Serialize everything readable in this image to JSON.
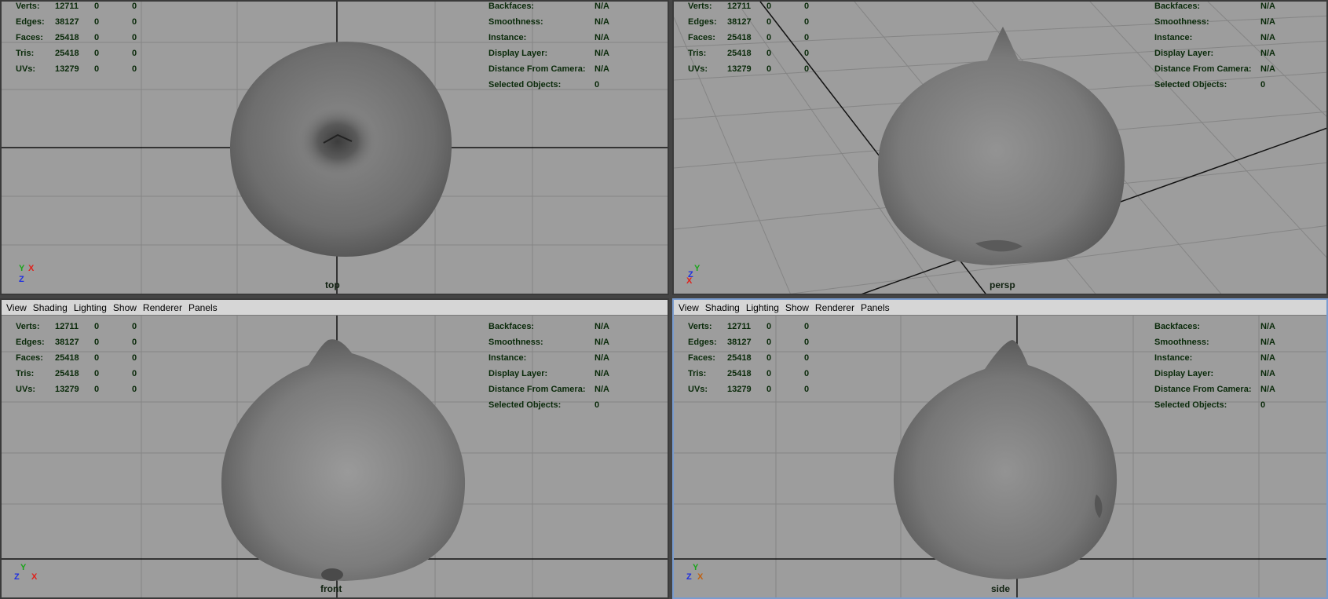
{
  "menu": [
    "View",
    "Shading",
    "Lighting",
    "Show",
    "Renderer",
    "Panels"
  ],
  "hud_left": [
    {
      "label": "Verts:",
      "a": "12711",
      "b": "0",
      "c": "0"
    },
    {
      "label": "Edges:",
      "a": "38127",
      "b": "0",
      "c": "0"
    },
    {
      "label": "Faces:",
      "a": "25418",
      "b": "0",
      "c": "0"
    },
    {
      "label": "Tris:",
      "a": "25418",
      "b": "0",
      "c": "0"
    },
    {
      "label": "UVs:",
      "a": "13279",
      "b": "0",
      "c": "0"
    }
  ],
  "hud_right": [
    {
      "label": "Backfaces:",
      "value": "N/A"
    },
    {
      "label": "Smoothness:",
      "value": "N/A"
    },
    {
      "label": "Instance:",
      "value": "N/A"
    },
    {
      "label": "Display Layer:",
      "value": "N/A"
    },
    {
      "label": "Distance From Camera:",
      "value": "N/A"
    },
    {
      "label": "Selected Objects:",
      "value": "0"
    }
  ],
  "panels": [
    {
      "camera": "top",
      "axes": [
        "Y",
        "X",
        "Z"
      ]
    },
    {
      "camera": "persp",
      "axes": [
        "Y",
        "Z",
        "X"
      ]
    },
    {
      "camera": "front",
      "axes": [
        "Y",
        "Z",
        "X"
      ]
    },
    {
      "camera": "side",
      "axes": [
        "Y",
        "Z",
        "X"
      ]
    }
  ],
  "colors": {
    "viewport_bg": "#9d9d9d",
    "hud_text": "#0a2a0a",
    "menubar_bg": "#d6d6d6",
    "axis_x": "#e0201a",
    "axis_y": "#1aa51a",
    "axis_z": "#2030e0"
  }
}
